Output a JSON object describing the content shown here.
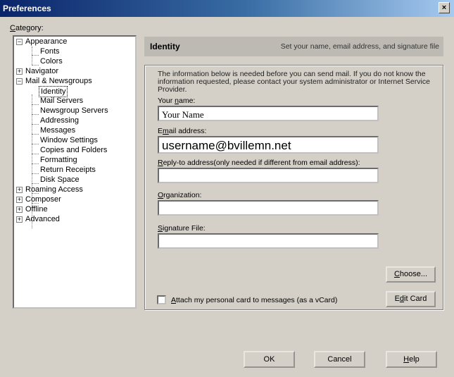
{
  "window": {
    "title": "Preferences",
    "close_glyph": "×"
  },
  "category_label": {
    "prefix": "C",
    "rest": "ategory:"
  },
  "tree": {
    "items": [
      {
        "label": "Appearance",
        "expander": "−"
      },
      {
        "label": "Fonts"
      },
      {
        "label": "Colors"
      },
      {
        "label": "Navigator",
        "expander": "+"
      },
      {
        "label": "Mail & Newsgroups",
        "expander": "−"
      },
      {
        "label": "Identity",
        "selected": true
      },
      {
        "label": "Mail Servers"
      },
      {
        "label": "Newsgroup Servers"
      },
      {
        "label": "Addressing"
      },
      {
        "label": "Messages"
      },
      {
        "label": "Window Settings"
      },
      {
        "label": "Copies and Folders"
      },
      {
        "label": "Formatting"
      },
      {
        "label": "Return Receipts"
      },
      {
        "label": "Disk Space"
      },
      {
        "label": "Roaming Access",
        "expander": "+"
      },
      {
        "label": "Composer",
        "expander": "+"
      },
      {
        "label": "Offline",
        "expander": "+"
      },
      {
        "label": "Advanced",
        "expander": "+"
      }
    ]
  },
  "header": {
    "title": "Identity",
    "description": "Set your name, email address, and signature file"
  },
  "info_text": "The information below is needed before you can send mail. If you do not know the information requested, please contact your system administrator or Internet Service Provider.",
  "fields": {
    "name": {
      "label_a": "Your ",
      "label_u": "n",
      "label_b": "ame:",
      "value": "Your Name"
    },
    "email": {
      "label_a": "E",
      "label_u": "m",
      "label_b": "ail address:",
      "value": "username@bvillemn.net"
    },
    "reply": {
      "label_u": "R",
      "label_b": "eply-to address(only needed if different from email address):",
      "value": ""
    },
    "org": {
      "label_u": "O",
      "label_b": "rganization:",
      "value": ""
    },
    "sig": {
      "label_u": "S",
      "label_b": "ignature File:",
      "value": ""
    }
  },
  "buttons": {
    "choose_u": "C",
    "choose_rest": "hoose...",
    "edit_a": "E",
    "edit_u": "d",
    "edit_b": "it Card",
    "ok": "OK",
    "cancel": "Cancel",
    "help_u": "H",
    "help_rest": "elp"
  },
  "vcard": {
    "label_u": "A",
    "label_b": "ttach my personal card to messages (as a vCard)",
    "checked": false
  }
}
